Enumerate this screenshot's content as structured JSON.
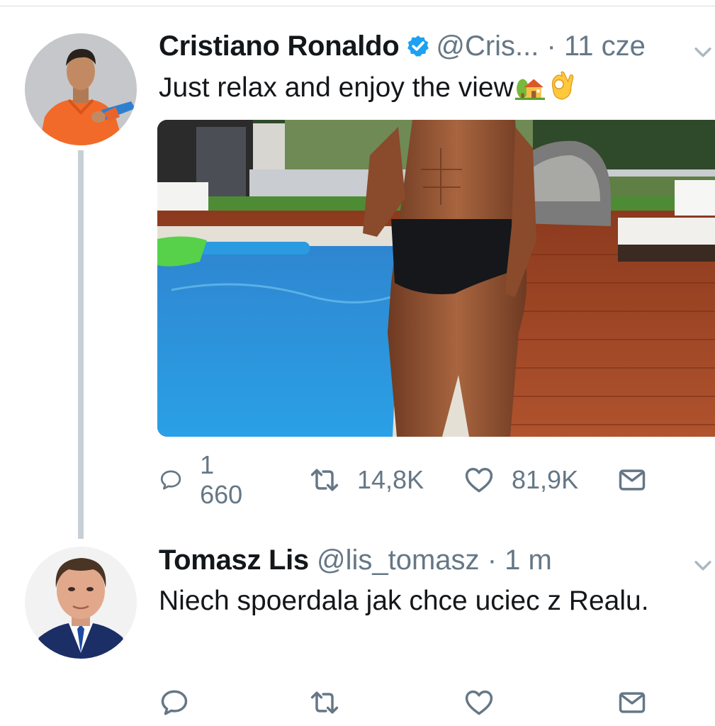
{
  "tweet": {
    "author_name": "Cristiano Ronaldo",
    "handle": "@Cris...",
    "separator": "·",
    "time": "11 cze",
    "text": "Just relax and enjoy the view",
    "emojis": [
      "house-with-garden-emoji",
      "ok-hand-emoji"
    ],
    "verified": true,
    "media_description_icon": "pool-photo",
    "actions": {
      "reply_count": "1 660",
      "retweet_count": "14,8K",
      "like_count": "81,9K"
    }
  },
  "reply": {
    "author_name": "Tomasz Lis",
    "handle": "@lis_tomasz",
    "separator": "·",
    "time": "1 m",
    "text": "Niech spoerdala jak chce uciec z Realu.",
    "actions": {
      "reply_count": "",
      "retweet_count": "",
      "like_count": ""
    }
  },
  "colors": {
    "secondary_text": "#657786",
    "verified_blue": "#1da1f2",
    "thread_line": "#c8d0d6"
  }
}
